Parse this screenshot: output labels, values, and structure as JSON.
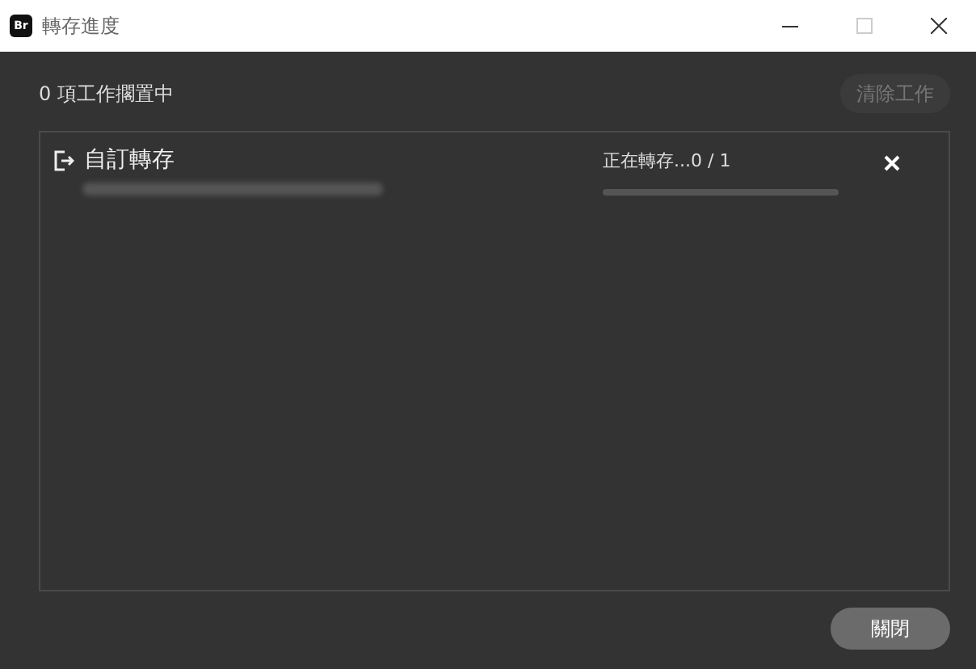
{
  "window": {
    "title": "轉存進度",
    "app_badge": "Br"
  },
  "queue_status": "0 項工作擱置中",
  "clear_button": {
    "label": "清除工作",
    "disabled": true
  },
  "jobs": [
    {
      "name": "自訂轉存",
      "status": "正在轉存...0 / 1",
      "level": 0
    }
  ],
  "close_button": "關閉"
}
